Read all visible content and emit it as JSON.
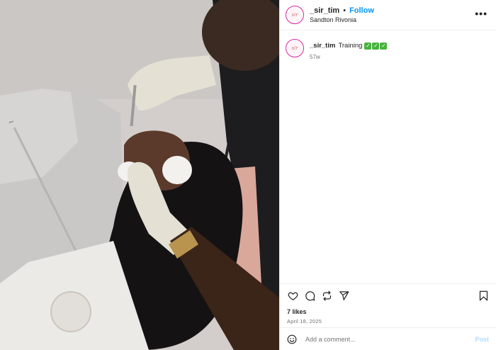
{
  "header": {
    "username": "_sir_tim",
    "separator": "•",
    "follow_label": "Follow",
    "location": "Sandton Rivonia",
    "more_label": "•••",
    "avatar_text": "sir"
  },
  "caption": {
    "username": "_sir_tim",
    "text": "Training",
    "checks": [
      "✓",
      "✓",
      "✓"
    ],
    "time_ago": "57w"
  },
  "actions": {
    "icons": [
      "heart-icon",
      "comment-icon",
      "share-icon",
      "send-icon",
      "bookmark-icon"
    ],
    "likes": "7 likes",
    "date": "April 18, 2025"
  },
  "comment": {
    "placeholder": "Add a comment...",
    "post_label": "Post"
  },
  "colors": {
    "follow": "#0095f6",
    "post_disabled": "#b3dbff",
    "check": "#47b33c",
    "avatar_ring": "#d6249f"
  }
}
